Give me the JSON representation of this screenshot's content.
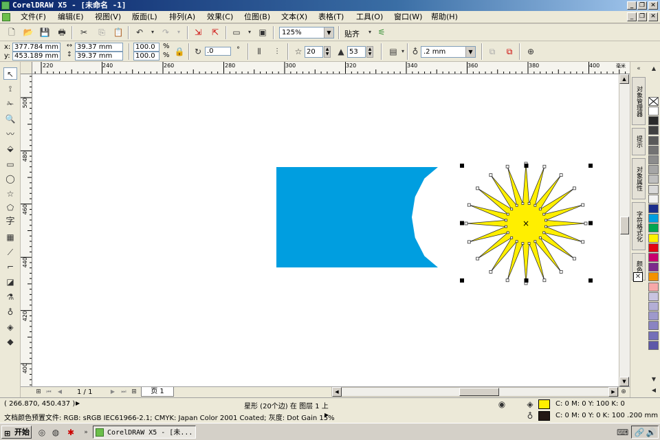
{
  "window": {
    "title": "CorelDRAW X5 - [未命名 -1]",
    "min_label": "_",
    "restore_label": "❐",
    "close_label": "✕"
  },
  "menu": {
    "items": [
      "文件(F)",
      "编辑(E)",
      "视图(V)",
      "版面(L)",
      "排列(A)",
      "效果(C)",
      "位图(B)",
      "文本(X)",
      "表格(T)",
      "工具(O)",
      "窗口(W)",
      "帮助(H)"
    ]
  },
  "std_toolbar": {
    "zoom_value": "125%",
    "snap_label": "贴齐"
  },
  "property_bar": {
    "x_label": "x:",
    "x_value": "377.784 mm",
    "y_label": "y:",
    "y_value": "453.189 mm",
    "w_value": "39.37 mm",
    "h_value": "39.37 mm",
    "sx_value": "100.0",
    "sy_value": "100.0",
    "pct1": "%",
    "pct2": "%",
    "rotation_value": ".0",
    "degree": "°",
    "points_value": "20",
    "sharpness_value": "53",
    "outline_value": ".2 mm"
  },
  "rulers": {
    "h_ticks": [
      "220",
      "240",
      "260",
      "280",
      "300",
      "320",
      "340",
      "360",
      "380",
      "400"
    ],
    "v_ticks": [
      "500",
      "480",
      "460",
      "440",
      "420",
      "400"
    ],
    "unit": "毫米"
  },
  "canvas": {
    "blue_rect_color": "#009ee0",
    "star_fill_color": "#ffef00",
    "star_points": 20,
    "star_sharpness": 53,
    "center_marker": "×"
  },
  "page_nav": {
    "page_count": "1 / 1",
    "page_tab": "页 1"
  },
  "status": {
    "cursor": "( 266.870, 450.437 )",
    "selection": "星形 (20个边) 在 图层 1 上",
    "fill_info": "C: 0 M: 0 Y: 100 K: 0",
    "outline_info": "C: 0 M: 0 Y: 0 K: 100  .200 mm",
    "color_profile": "文档颜色预置文件: RGB: sRGB IEC61966-2.1; CMYK: Japan Color 2001 Coated; 灰度: Dot Gain 15%",
    "fill_color": "#ffef00",
    "outline_color": "#231815"
  },
  "docker": {
    "tabs": [
      "对象管理器",
      "提示",
      "对象属性",
      "字符格式化",
      "颜色"
    ]
  },
  "palette": {
    "colors": [
      "#ffffff",
      "#2a2a2a",
      "#404040",
      "#595959",
      "#737373",
      "#8c8c8c",
      "#a6a6a6",
      "#bfbfbf",
      "#d9d9d9",
      "#f2f2f2",
      "#1a2d8c",
      "#009ee0",
      "#00a650",
      "#fff200",
      "#e30613",
      "#c8006e",
      "#7d2a8c",
      "#f39200",
      "#f7a8a8",
      "#c9c4e0",
      "#b3aed6",
      "#9e99cc",
      "#8a84c2",
      "#7570b8",
      "#5d58a8"
    ]
  },
  "taskbar": {
    "start_label": "开始",
    "task_label": "CorelDRAW X5 - [未..."
  }
}
